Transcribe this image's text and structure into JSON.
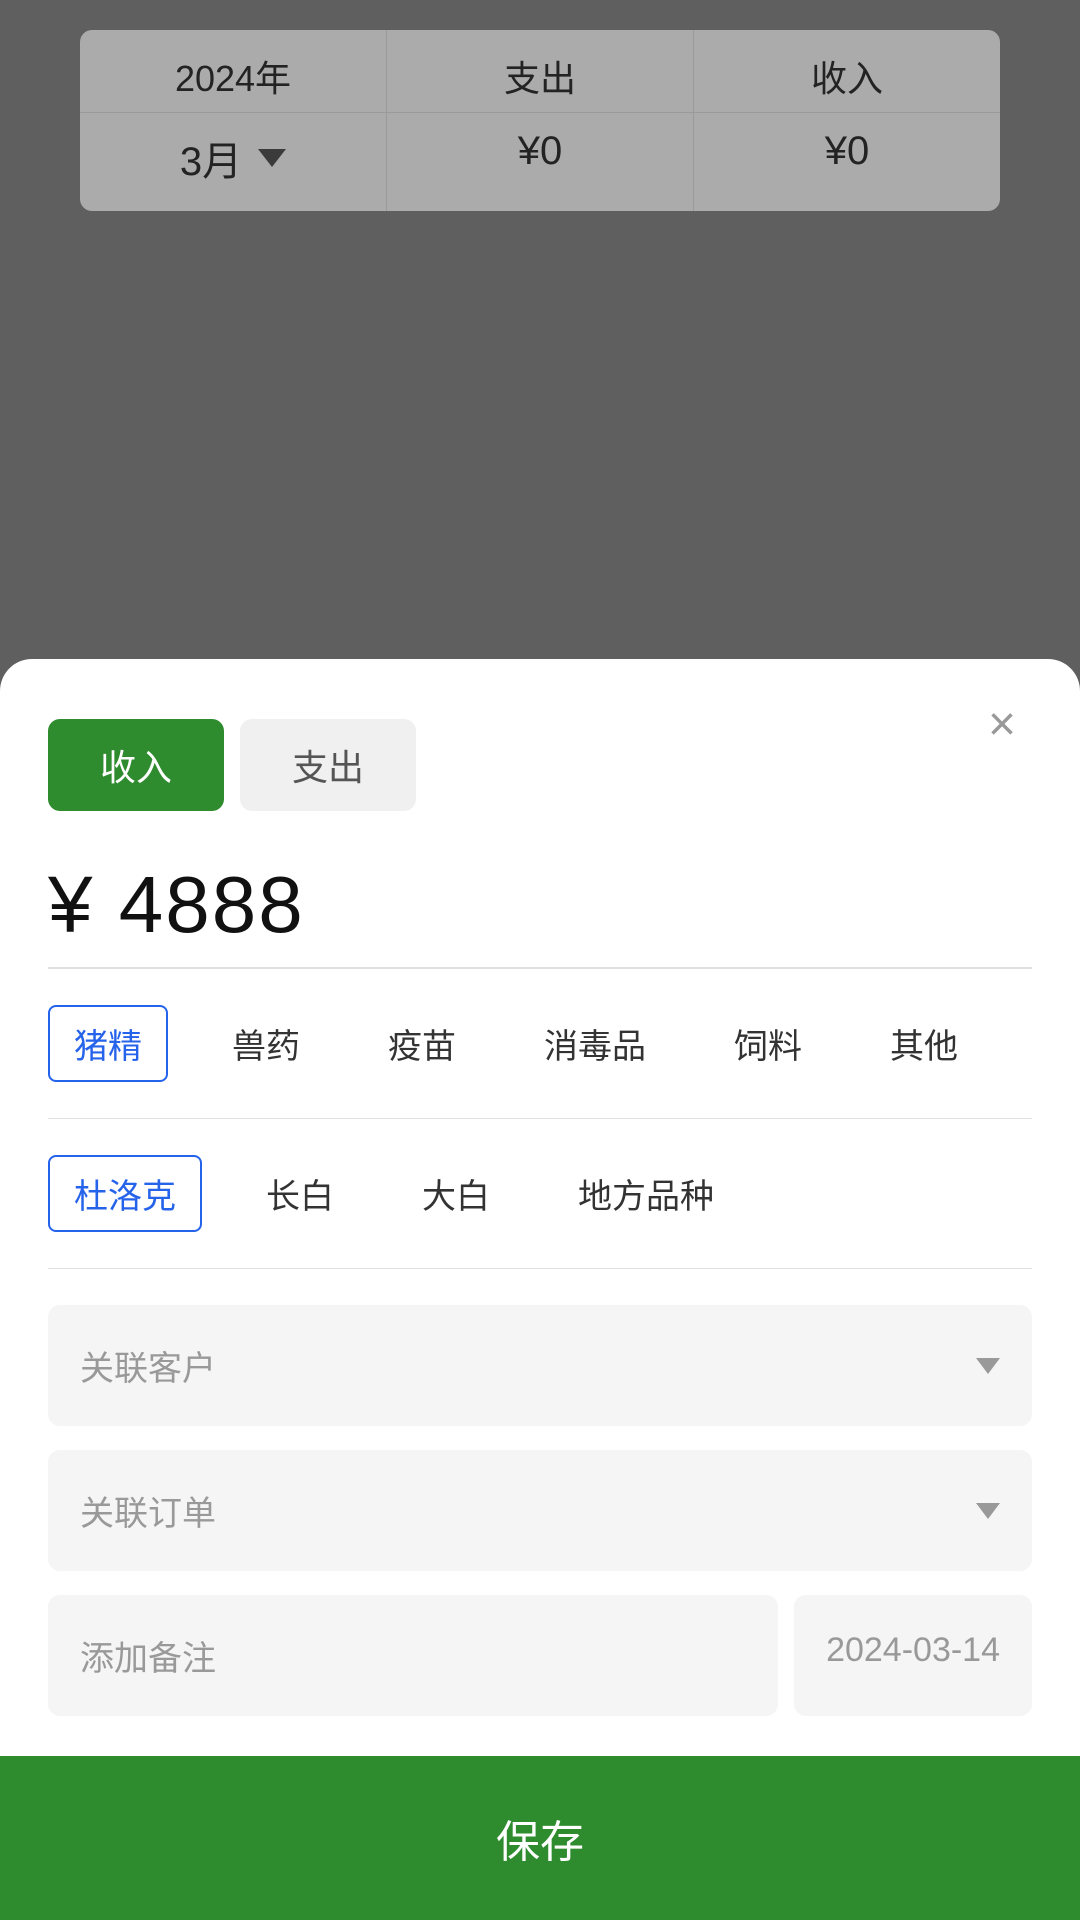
{
  "background": {
    "year": "2024年",
    "month": "3月",
    "expense_label": "支出",
    "income_label": "收入",
    "expense_value": "¥0",
    "income_value": "¥0"
  },
  "modal": {
    "close_label": "×",
    "tab_income": "收入",
    "tab_expense": "支出",
    "active_tab": "income",
    "amount": "¥ 4888",
    "categories": [
      {
        "id": "pig_semen",
        "label": "猪精",
        "selected": true
      },
      {
        "id": "vet_medicine",
        "label": "兽药",
        "selected": false
      },
      {
        "id": "vaccine",
        "label": "疫苗",
        "selected": false
      },
      {
        "id": "disinfectant",
        "label": "消毒品",
        "selected": false
      },
      {
        "id": "feed",
        "label": "饲料",
        "selected": false
      },
      {
        "id": "other",
        "label": "其他",
        "selected": false
      }
    ],
    "breeds": [
      {
        "id": "duroc",
        "label": "杜洛克",
        "selected": true
      },
      {
        "id": "landrace",
        "label": "长白",
        "selected": false
      },
      {
        "id": "large_white",
        "label": "大白",
        "selected": false
      },
      {
        "id": "local",
        "label": "地方品种",
        "selected": false
      }
    ],
    "customer_placeholder": "关联客户",
    "order_placeholder": "关联订单",
    "note_placeholder": "添加备注",
    "date_value": "2024-03-14",
    "save_label": "保存"
  }
}
